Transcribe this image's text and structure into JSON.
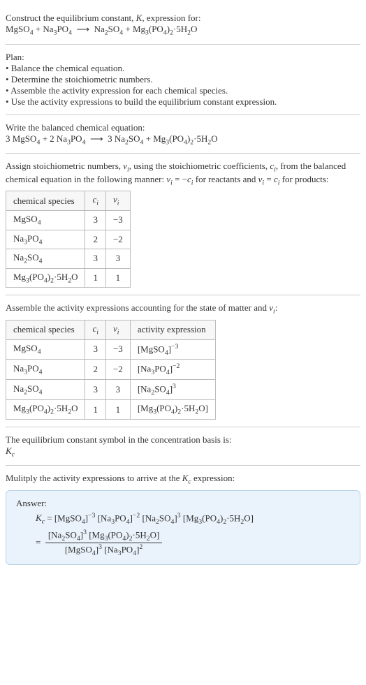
{
  "intro": {
    "line1": "Construct the equilibrium constant, K, expression for:",
    "eq": "MgSO₄ + Na₃PO₄ ⟶ Na₂SO₄ + Mg₃(PO₄)₂·5H₂O"
  },
  "plan": {
    "heading": "Plan:",
    "b1": "• Balance the chemical equation.",
    "b2": "• Determine the stoichiometric numbers.",
    "b3": "• Assemble the activity expression for each chemical species.",
    "b4": "• Use the activity expressions to build the equilibrium constant expression."
  },
  "balanced": {
    "heading": "Write the balanced chemical equation:",
    "eq": "3 MgSO₄ + 2 Na₃PO₄ ⟶ 3 Na₂SO₄ + Mg₃(PO₄)₂·5H₂O"
  },
  "stoich": {
    "intro1": "Assign stoichiometric numbers, νᵢ, using the stoichiometric coefficients, cᵢ, from the balanced chemical equation in the following manner: νᵢ = −cᵢ for reactants and νᵢ = cᵢ for products:",
    "h_species": "chemical species",
    "h_ci": "cᵢ",
    "h_vi": "νᵢ",
    "rows": [
      {
        "sp": "MgSO₄",
        "c": "3",
        "v": "−3"
      },
      {
        "sp": "Na₃PO₄",
        "c": "2",
        "v": "−2"
      },
      {
        "sp": "Na₂SO₄",
        "c": "3",
        "v": "3"
      },
      {
        "sp": "Mg₃(PO₄)₂·5H₂O",
        "c": "1",
        "v": "1"
      }
    ]
  },
  "activity": {
    "intro": "Assemble the activity expressions accounting for the state of matter and νᵢ:",
    "h_species": "chemical species",
    "h_ci": "cᵢ",
    "h_vi": "νᵢ",
    "h_act": "activity expression",
    "rows": [
      {
        "sp": "MgSO₄",
        "c": "3",
        "v": "−3",
        "a": "[MgSO₄]⁻³"
      },
      {
        "sp": "Na₃PO₄",
        "c": "2",
        "v": "−2",
        "a": "[Na₃PO₄]⁻²"
      },
      {
        "sp": "Na₂SO₄",
        "c": "3",
        "v": "3",
        "a": "[Na₂SO₄]³"
      },
      {
        "sp": "Mg₃(PO₄)₂·5H₂O",
        "c": "1",
        "v": "1",
        "a": "[Mg₃(PO₄)₂·5H₂O]"
      }
    ]
  },
  "symbol": {
    "line1": "The equilibrium constant symbol in the concentration basis is:",
    "line2": "K_c"
  },
  "multiply": {
    "line": "Mulitply the activity expressions to arrive at the K_c expression:"
  },
  "answer": {
    "label": "Answer:",
    "kc_eq": "K_c = [MgSO₄]⁻³ [Na₃PO₄]⁻² [Na₂SO₄]³ [Mg₃(PO₄)₂·5H₂O]",
    "frac_num": "[Na₂SO₄]³ [Mg₃(PO₄)₂·5H₂O]",
    "frac_den": "[MgSO₄]³ [Na₃PO₄]²",
    "equals": " = "
  }
}
